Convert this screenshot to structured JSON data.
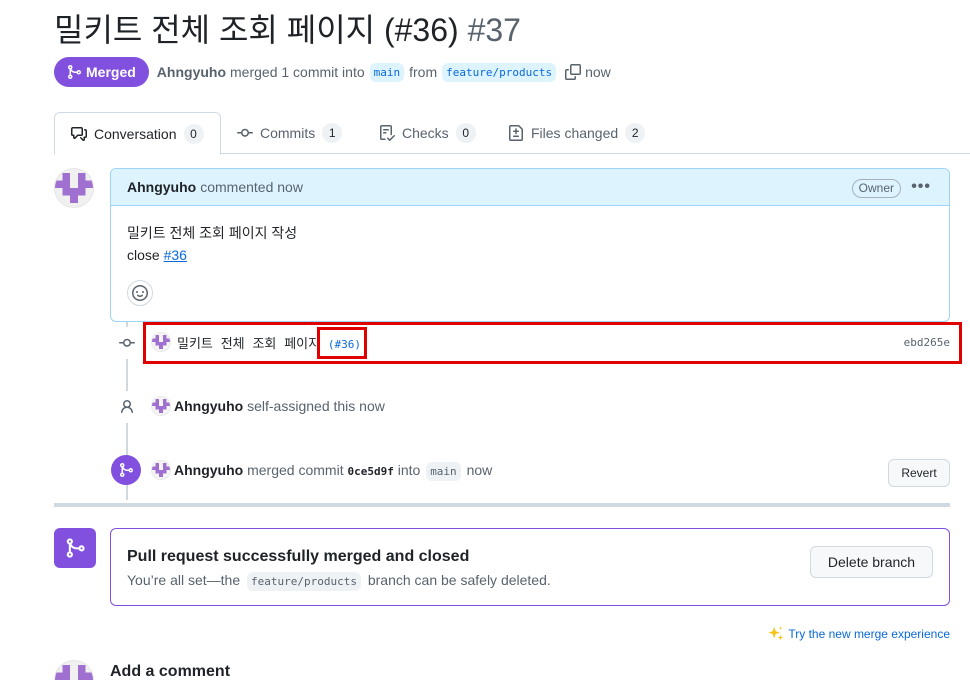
{
  "pr": {
    "title": "밀키트 전체 조회 페이지 (#36)",
    "number": "#37"
  },
  "meta": {
    "status_label": "Merged",
    "author": "Ahngyuho",
    "merged_text": "merged 1 commit into",
    "base_branch": "main",
    "from_text": "from",
    "head_branch": "feature/products",
    "time": "now"
  },
  "tabs": [
    {
      "label": "Conversation",
      "count": "0",
      "icon": "comment-discussion-icon"
    },
    {
      "label": "Commits",
      "count": "1",
      "icon": "git-commit-icon"
    },
    {
      "label": "Checks",
      "count": "0",
      "icon": "checklist-icon"
    },
    {
      "label": "Files changed",
      "count": "2",
      "icon": "file-diff-icon"
    }
  ],
  "comment": {
    "author": "Ahngyuho",
    "action": "commented now",
    "badge": "Owner",
    "menu": "•••",
    "body_line1": "밀키트 전체 조회 페이지 작성",
    "body_close": "close",
    "body_ref": "#36"
  },
  "timeline": {
    "commit_message": "밀키트 전체 조회 페이지",
    "commit_ref": "(#36)",
    "commit_sha": "ebd265e",
    "assign_author": "Ahngyuho",
    "assign_text": "self-assigned this now",
    "merge_author": "Ahngyuho",
    "merge_text": "merged commit",
    "merge_sha": "0ce5d9f",
    "merge_into": "into",
    "merge_base": "main",
    "merge_time": "now",
    "revert_label": "Revert"
  },
  "merge_box": {
    "title": "Pull request successfully merged and closed",
    "sub_before": "You’re all set—the",
    "branch": "feature/products",
    "sub_after": "branch can be safely deleted.",
    "delete_label": "Delete branch"
  },
  "footer": {
    "try_label": "Try the new merge experience",
    "add_comment": "Add a comment"
  },
  "colors": {
    "merged_purple": "#8250df",
    "link_blue": "#0969da",
    "highlight_red": "#e00000",
    "comment_header_bg": "#ddf4ff"
  }
}
